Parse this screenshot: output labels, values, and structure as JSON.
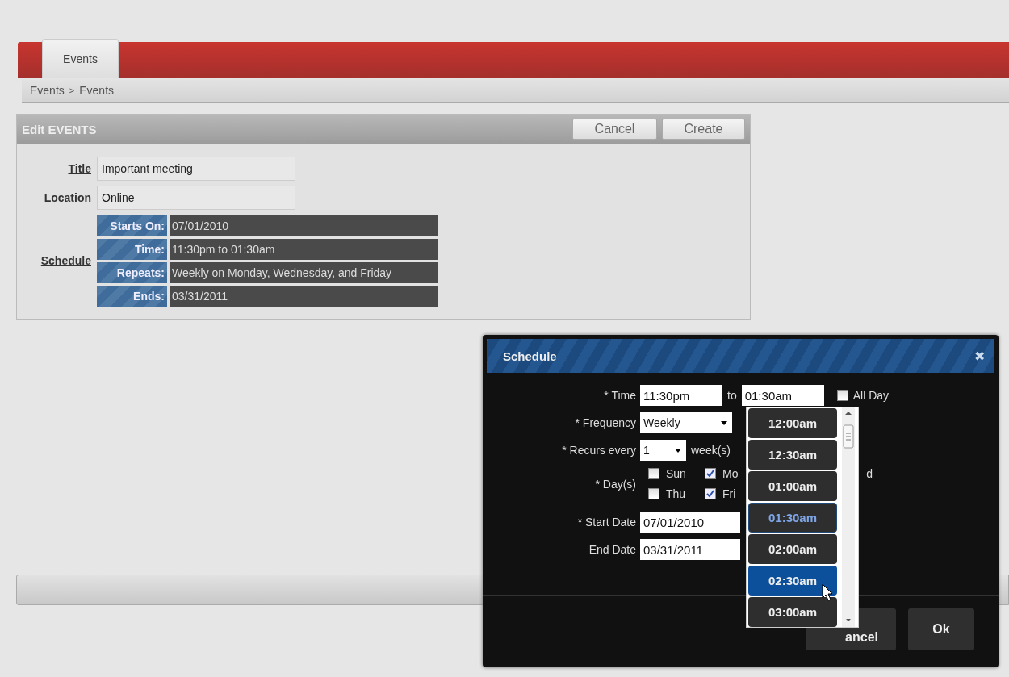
{
  "tabs": [
    {
      "label": "Events",
      "selected": true
    }
  ],
  "breadcrumb": [
    "Events",
    "Events"
  ],
  "breadcrumb_separator": ">",
  "edit_panel": {
    "title": "Edit EVENTS",
    "buttons": [
      "Cancel",
      "Create"
    ],
    "fields": [
      {
        "label": "Title",
        "value": "Important meeting"
      },
      {
        "label": "Location",
        "value": "Online"
      }
    ],
    "schedule": {
      "label": "Schedule",
      "rows": [
        {
          "label": "Starts On:",
          "value": "07/01/2010"
        },
        {
          "label": "Time:",
          "value": "11:30pm to 01:30am"
        },
        {
          "label": "Repeats:",
          "value": "Weekly on Monday, Wednesday, and Friday"
        },
        {
          "label": "Ends:",
          "value": "03/31/2011"
        }
      ]
    }
  },
  "dialog": {
    "title": "Schedule",
    "close": "✖",
    "time_label": "* Time",
    "time_from": "11:30pm",
    "time_to_word": "to",
    "time_to": "01:30am",
    "all_day": {
      "label": "All Day",
      "checked": false
    },
    "frequency_label": "* Frequency",
    "frequency": "Weekly",
    "recurs_label": "* Recurs every",
    "recurs": "1",
    "recurs_unit": "week(s)",
    "days_label": "* Day(s)",
    "days": [
      {
        "kind": "checkbox",
        "label": "Sun",
        "checked": false
      },
      {
        "kind": "checkbox",
        "label": "Mo",
        "checked": true
      },
      {
        "kind": "text",
        "label": "d"
      },
      {
        "kind": "checkbox",
        "label": "Thu",
        "checked": false
      },
      {
        "kind": "checkbox",
        "label": "Fri",
        "checked": true
      }
    ],
    "start_label": "* Start Date",
    "start_date": "07/01/2010",
    "end_label": "End Date",
    "end_date": "03/31/2011",
    "buttons": [
      "ancel",
      "Ok"
    ],
    "time_options": [
      {
        "label": "12:00am",
        "selected": false,
        "hovered": false
      },
      {
        "label": "12:30am",
        "selected": false,
        "hovered": false
      },
      {
        "label": "01:00am",
        "selected": false,
        "hovered": false
      },
      {
        "label": "01:30am",
        "selected": true,
        "hovered": false
      },
      {
        "label": "02:00am",
        "selected": false,
        "hovered": false
      },
      {
        "label": "02:30am",
        "selected": false,
        "hovered": true
      },
      {
        "label": "03:00am",
        "selected": false,
        "hovered": false
      }
    ]
  }
}
